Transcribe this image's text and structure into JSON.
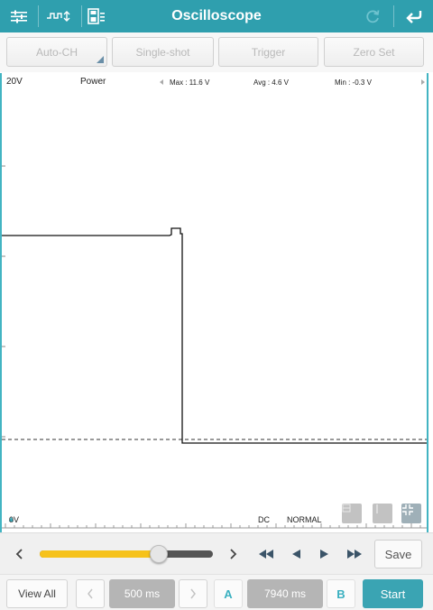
{
  "app": {
    "title": "Oscilloscope"
  },
  "toolbar": {
    "icons": [
      "sliders-icon",
      "waveform-icon",
      "save-file-icon",
      "refresh-icon",
      "back-icon"
    ]
  },
  "controls": {
    "auto_ch": "Auto-CH",
    "single_shot": "Single-shot",
    "trigger": "Trigger",
    "zero_set": "Zero Set"
  },
  "scope": {
    "range": "20V",
    "channel": "Power",
    "max": "Max : 11.6 V",
    "avg": "Avg : 4.6 V",
    "min": "Min : -0.3 V",
    "zero_marker": "0V",
    "coupling": "DC",
    "mode": "NORMAL",
    "trace_color": "#111111",
    "border_color": "#42b4c2"
  },
  "playback": {
    "position_fraction": 0.69,
    "save": "Save",
    "slider_color": "#f6c21b"
  },
  "bottom": {
    "view_all": "View All",
    "time_base": "500 ms",
    "a_label": "A",
    "cursor_value": "7940 ms",
    "b_label": "B",
    "start": "Start",
    "accent": "#3aa4b3"
  }
}
